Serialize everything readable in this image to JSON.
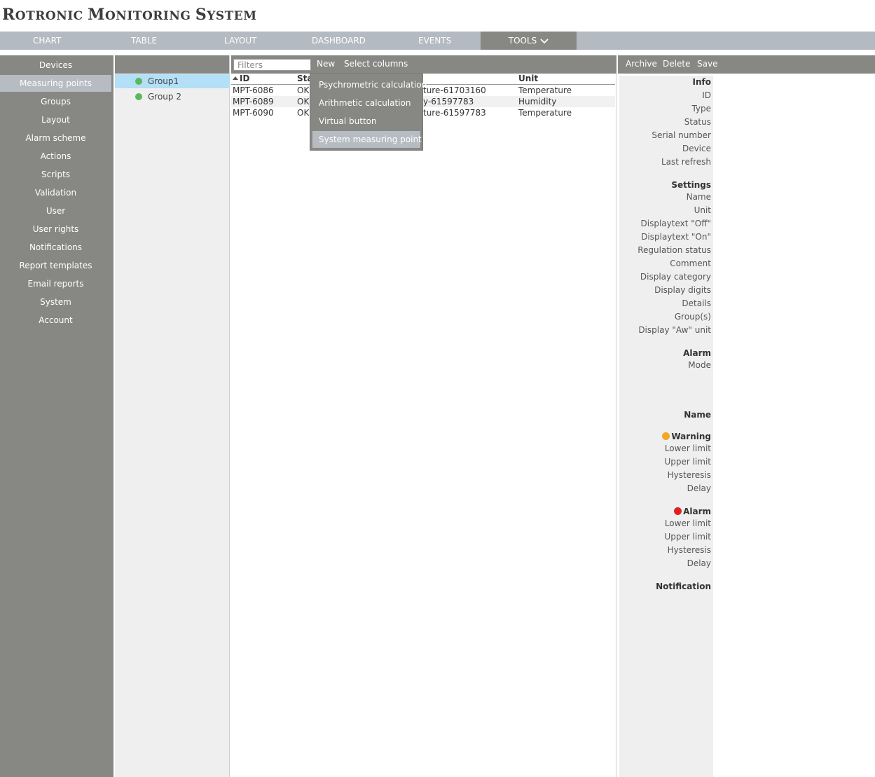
{
  "app": {
    "title_first_cap": "R",
    "title_first_rest": "OTRONIC ",
    "title_second_cap": "M",
    "title_second_rest": "ONITORING ",
    "title_third_cap": "S",
    "title_third_rest": "YSTEM"
  },
  "topnav": {
    "chart": "CHART",
    "table": "TABLE",
    "layout": "LAYOUT",
    "dashboard": "DASHBOARD",
    "events": "EVENTS",
    "tools": "TOOLS",
    "active": "TOOLS"
  },
  "sidebar": {
    "items": [
      "Devices",
      "Measuring points",
      "Groups",
      "Layout",
      "Alarm scheme",
      "Actions",
      "Scripts",
      "Validation",
      "User",
      "User rights",
      "Notifications",
      "Report templates",
      "Email reports",
      "System",
      "Account"
    ],
    "selected": "Measuring points"
  },
  "groups": [
    {
      "name": "Group1",
      "selected": true
    },
    {
      "name": "Group 2",
      "selected": false
    }
  ],
  "toolbar": {
    "filter_placeholder": "Filters",
    "new_label": "New",
    "select_columns_label": "Select columns"
  },
  "table": {
    "columns": {
      "id": "ID",
      "status": "Sta",
      "unit": "Unit"
    },
    "rows": [
      {
        "id": "MPT-6086",
        "status": "OK",
        "name": "ture-61703160",
        "unit": "Temperature"
      },
      {
        "id": "MPT-6089",
        "status": "OK",
        "name": "y-61597783",
        "unit": "Humidity"
      },
      {
        "id": "MPT-6090",
        "status": "OK",
        "name": "ture-61597783",
        "unit": "Temperature"
      }
    ]
  },
  "new_menu": {
    "items": [
      "Psychrometric calculation",
      "Arithmetic calculation",
      "Virtual button",
      "System measuring point"
    ],
    "highlighted": "System measuring point"
  },
  "detail_toolbar": {
    "archive": "Archive",
    "delete": "Delete",
    "save": "Save"
  },
  "details": {
    "info_header": "Info",
    "info": [
      "ID",
      "Type",
      "Status",
      "Serial number",
      "Device",
      "Last refresh"
    ],
    "settings_header": "Settings",
    "settings": [
      "Name",
      "Unit",
      "Displaytext \"Off\"",
      "Displaytext \"On\"",
      "Regulation status",
      "Comment",
      "Display category",
      "Display digits",
      "Details",
      "Group(s)",
      "Display \"Aw\" unit"
    ],
    "alarm_header": "Alarm",
    "alarm_mode": "Mode",
    "name_header": "Name",
    "warning_header": "Warning",
    "warning": [
      "Lower limit",
      "Upper limit",
      "Hysteresis",
      "Delay"
    ],
    "alarm2_header": "Alarm",
    "alarm2": [
      "Lower limit",
      "Upper limit",
      "Hysteresis",
      "Delay"
    ],
    "notification_header": "Notification",
    "warning_color": "#f5a623",
    "alarm_color": "#e02020"
  }
}
